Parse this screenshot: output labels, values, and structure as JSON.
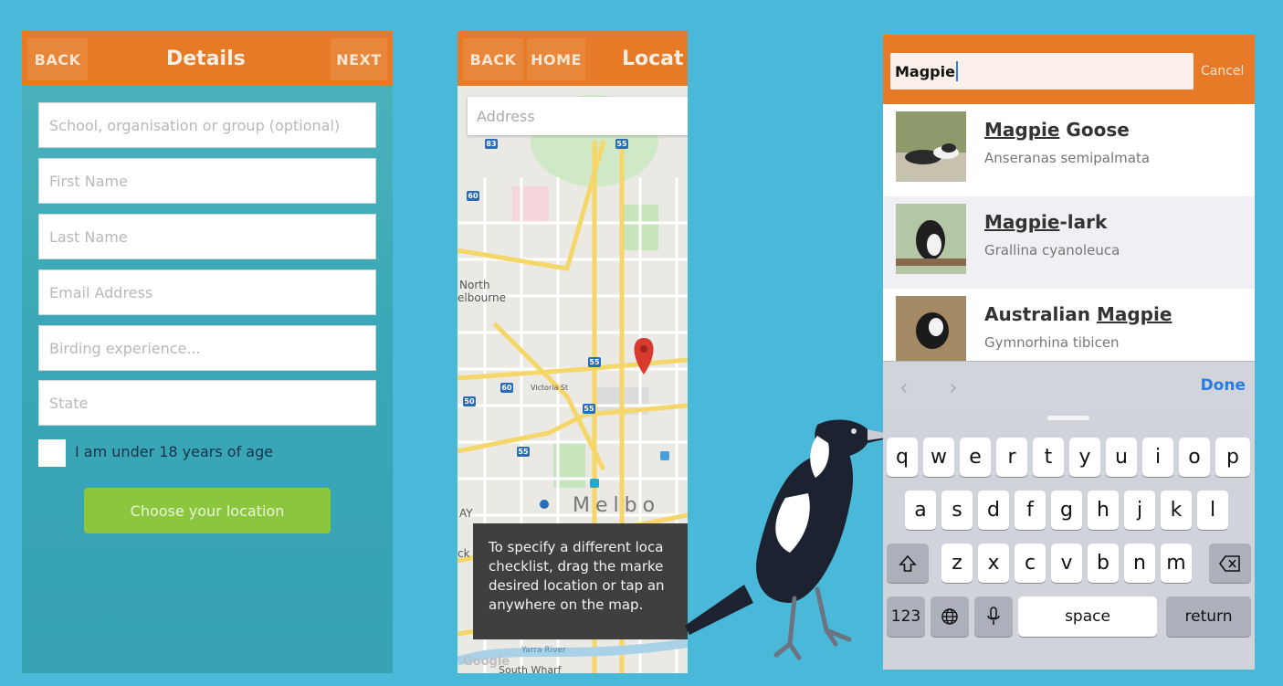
{
  "details_screen": {
    "back_label": "BACK",
    "title": "Details",
    "next_label": "NEXT",
    "fields": [
      {
        "placeholder": "School, organisation or group (optional)"
      },
      {
        "placeholder": "First Name"
      },
      {
        "placeholder": "Last Name"
      },
      {
        "placeholder": "Email Address"
      },
      {
        "placeholder": "Birding experience..."
      },
      {
        "placeholder": "State"
      }
    ],
    "under18_label": "I am under 18 years of age",
    "under18_checked": false,
    "choose_location_label": "Choose your location",
    "colors": {
      "navbar": "#e67a27",
      "background": "#3aa8b6",
      "button": "#8cc63e"
    }
  },
  "location_screen": {
    "back_label": "BACK",
    "home_label": "HOME",
    "title": "Locat",
    "address_placeholder": "Address",
    "map_labels": {
      "north_melbourne_1": "North",
      "north_melbourne_2": "elbourne",
      "victoria_st": "Victoria St",
      "melbourne": "Melbo",
      "yarra_river": "Yarra River",
      "south_wharf": "South Wharf",
      "google": "Google",
      "ay": "AY",
      "ck": "ck"
    },
    "route_shields": [
      "83",
      "55",
      "60",
      "55",
      "60",
      "55",
      "50",
      "55"
    ],
    "tooltip_lines": [
      "To specify a different loca",
      "checklist, drag the marke",
      "desired location or tap an",
      "anywhere on the map."
    ]
  },
  "search_screen": {
    "query": "Magpie",
    "cancel_label": "Cancel",
    "results": [
      {
        "name_match": "Magpie",
        "name_rest": " Goose",
        "name_prefix": "",
        "scientific": "Anseranas semipalmata"
      },
      {
        "name_match": "Magpie",
        "name_rest": "-lark",
        "name_prefix": "",
        "scientific": "Grallina cyanoleuca"
      },
      {
        "name_match": "Magpie",
        "name_rest": "",
        "name_prefix": "Australian ",
        "scientific": "Gymnorhina tibicen"
      }
    ],
    "toolbar": {
      "prev_icon": "chevron-left-icon",
      "next_icon": "chevron-right-icon",
      "done_label": "Done"
    },
    "keyboard": {
      "row1": [
        "q",
        "w",
        "e",
        "r",
        "t",
        "y",
        "u",
        "i",
        "o",
        "p"
      ],
      "row2": [
        "a",
        "s",
        "d",
        "f",
        "g",
        "h",
        "j",
        "k",
        "l"
      ],
      "row3": [
        "z",
        "x",
        "c",
        "v",
        "b",
        "n",
        "m"
      ],
      "numbers_label": "123",
      "space_label": "space",
      "return_label": "return"
    }
  }
}
